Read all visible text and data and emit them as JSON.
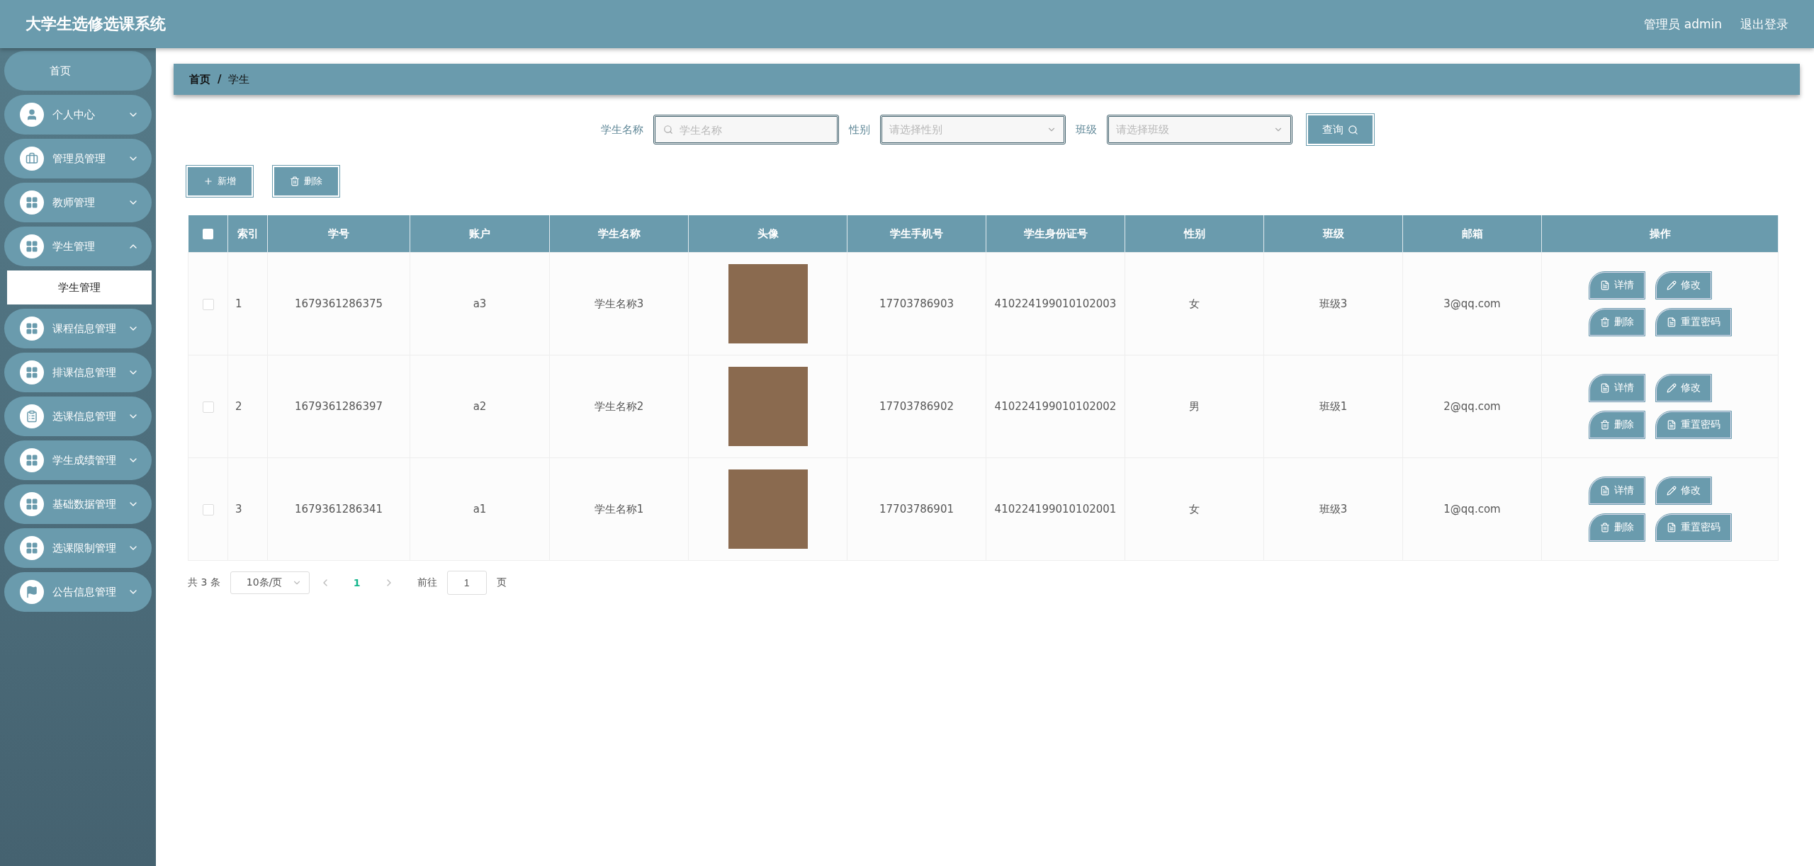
{
  "header": {
    "title": "大学生选修选课系统",
    "user": "管理员 admin",
    "logout": "退出登录"
  },
  "sidebar": {
    "items": [
      {
        "label": "首页",
        "kind": "home"
      },
      {
        "label": "个人中心",
        "kind": "user",
        "expanded": false
      },
      {
        "label": "管理员管理",
        "kind": "case",
        "expanded": false
      },
      {
        "label": "教师管理",
        "kind": "grid",
        "expanded": false
      },
      {
        "label": "学生管理",
        "kind": "grid",
        "expanded": true,
        "children": [
          {
            "label": "学生管理",
            "selected": true
          }
        ]
      },
      {
        "label": "课程信息管理",
        "kind": "grid",
        "expanded": false
      },
      {
        "label": "排课信息管理",
        "kind": "grid",
        "expanded": false
      },
      {
        "label": "选课信息管理",
        "kind": "list",
        "expanded": false
      },
      {
        "label": "学生成绩管理",
        "kind": "grid",
        "expanded": false
      },
      {
        "label": "基础数据管理",
        "kind": "grid",
        "expanded": false
      },
      {
        "label": "选课限制管理",
        "kind": "grid",
        "expanded": false
      },
      {
        "label": "公告信息管理",
        "kind": "flag",
        "expanded": false
      }
    ]
  },
  "breadcrumb": {
    "items": [
      "首页",
      "学生"
    ],
    "separator": "/"
  },
  "search": {
    "fields": [
      {
        "label": "学生名称",
        "kind": "input",
        "placeholder": "学生名称"
      },
      {
        "label": "性别",
        "kind": "select",
        "placeholder": "请选择性别"
      },
      {
        "label": "班级",
        "kind": "select",
        "placeholder": "请选择班级"
      }
    ],
    "button": "查询"
  },
  "actions": [
    {
      "label": "新增",
      "kind": "add"
    },
    {
      "label": "删除",
      "kind": "delete"
    }
  ],
  "table": {
    "all_checked": false,
    "columns": [
      "索引",
      "学号",
      "账户",
      "学生名称",
      "头像",
      "学生手机号",
      "学生身份证号",
      "性别",
      "班级",
      "邮箱",
      "操作"
    ],
    "rows": [
      {
        "checked": false,
        "index": "1",
        "number": "1679361286375",
        "account": "a3",
        "name": "学生名称3",
        "phone": "17703786903",
        "id_card": "410224199010102003",
        "gender": "女",
        "class": "班级3",
        "email": "3@qq.com",
        "actions": [
          {
            "label": "详情",
            "kind": "doc"
          },
          {
            "label": "修改",
            "kind": "edit"
          },
          {
            "label": "删除",
            "kind": "delete"
          },
          {
            "label": "重置密码",
            "kind": "doc"
          }
        ]
      },
      {
        "checked": false,
        "index": "2",
        "number": "1679361286397",
        "account": "a2",
        "name": "学生名称2",
        "phone": "17703786902",
        "id_card": "410224199010102002",
        "gender": "男",
        "class": "班级1",
        "email": "2@qq.com",
        "actions": [
          {
            "label": "详情",
            "kind": "doc"
          },
          {
            "label": "修改",
            "kind": "edit"
          },
          {
            "label": "删除",
            "kind": "delete"
          },
          {
            "label": "重置密码",
            "kind": "doc"
          }
        ]
      },
      {
        "checked": false,
        "index": "3",
        "number": "1679361286341",
        "account": "a1",
        "name": "学生名称1",
        "phone": "17703786901",
        "id_card": "410224199010102001",
        "gender": "女",
        "class": "班级3",
        "email": "1@qq.com",
        "actions": [
          {
            "label": "详情",
            "kind": "doc"
          },
          {
            "label": "修改",
            "kind": "edit"
          },
          {
            "label": "删除",
            "kind": "delete"
          },
          {
            "label": "重置密码",
            "kind": "doc"
          }
        ]
      }
    ]
  },
  "pagination": {
    "total": "共 3 条",
    "page_size": "10条/页",
    "pages": [
      {
        "label": "1",
        "selected": true
      }
    ],
    "goto_label": "前往",
    "goto_value": "1",
    "page_unit": "页"
  }
}
